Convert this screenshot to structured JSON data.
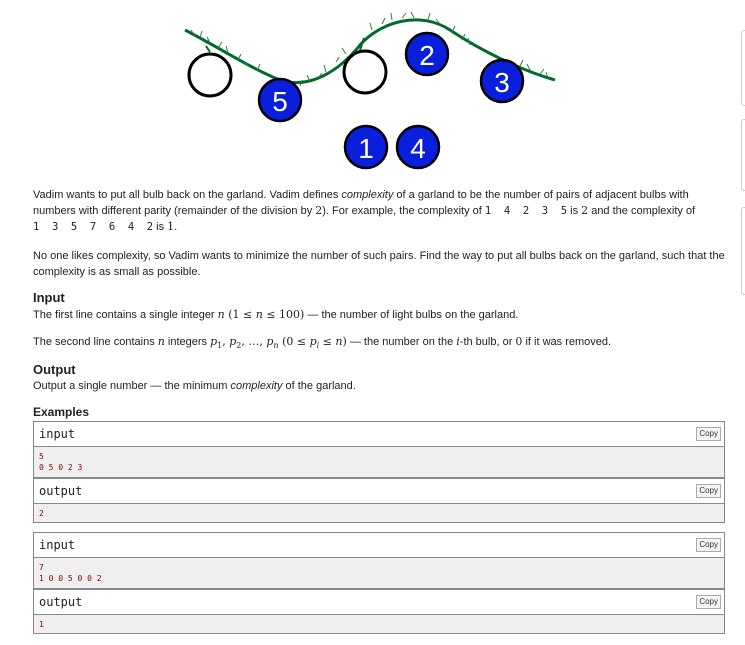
{
  "illustration": {
    "bulbs_hanging": [
      "5",
      "2",
      "3"
    ],
    "bulbs_removed": [
      "1",
      "4"
    ]
  },
  "statement": {
    "p1": {
      "a": "Vadim wants to put all bulb back on the garland. Vadim defines ",
      "b": "complexity",
      "c": " of a garland to be the number of pairs of adjacent bulbs with numbers with different parity (remainder of the division by ",
      "d": "2",
      "e": "). For example, the complexity of ",
      "f": "1  4  2  3  5",
      "g": " is ",
      "h": "2",
      "i": " and the complexity of ",
      "j": "1  3  5  7  6  4  2",
      "k": " is ",
      "l": "1",
      "m": "."
    },
    "p2": "No one likes complexity, so Vadim wants to minimize the number of such pairs. Find the way to put all bulbs back on the garland, such that the complexity is as small as possible."
  },
  "input_section": {
    "title": "Input",
    "l1_a": "The first line contains a single integer ",
    "l1_b": "n",
    "l1_c": " (1 ≤ ",
    "l1_d": "n",
    "l1_e": " ≤ 100)",
    "l1_f": " — the number of light bulbs on the garland.",
    "l2_a": "The second line contains ",
    "l2_b": "n",
    "l2_c": " integers ",
    "l2_d": "p",
    "l2_e": "1",
    "l2_f": ", ",
    "l2_g": "p",
    "l2_h": "2",
    "l2_i": ", …, ",
    "l2_j": "p",
    "l2_k": "n",
    "l2_l": " (0 ≤ ",
    "l2_m": "p",
    "l2_n": "i",
    "l2_o": " ≤ ",
    "l2_p": "n",
    "l2_q": ")",
    "l2_r": " — the number on the ",
    "l2_s": "i",
    "l2_t": "-th bulb, or ",
    "l2_u": "0",
    "l2_v": " if it was removed."
  },
  "output_section": {
    "title": "Output",
    "a": "Output a single number — the minimum ",
    "b": "complexity",
    "c": " of the garland."
  },
  "examples": {
    "title": "Examples",
    "input_label": "input",
    "output_label": "output",
    "copy_label": "Copy",
    "ex1": {
      "input": [
        "5",
        "0 5 0 2 3"
      ],
      "output": [
        "2"
      ]
    },
    "ex2": {
      "input": [
        "7",
        "1 0 0 5 0 0 2"
      ],
      "output": [
        "1"
      ]
    }
  }
}
